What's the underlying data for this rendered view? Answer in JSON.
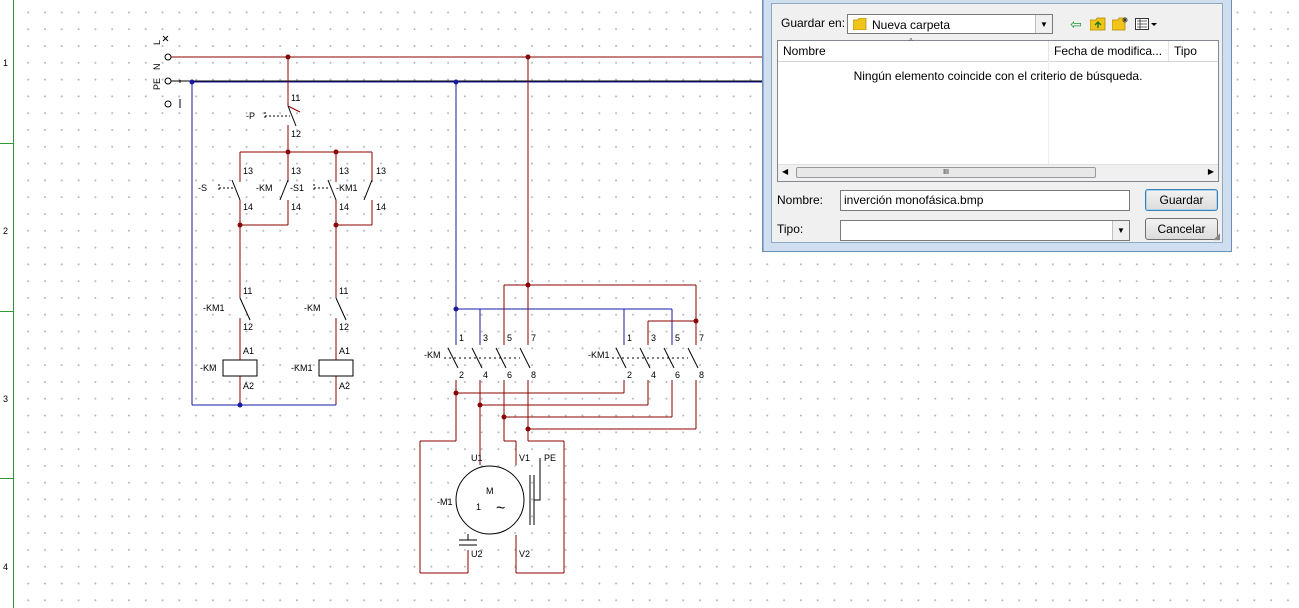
{
  "ruler": {
    "numbers": [
      "1",
      "2",
      "3",
      "4"
    ]
  },
  "schematic": {
    "supply_labels": [
      "L",
      "N",
      "PE"
    ],
    "control_labels": {
      "p": "-P",
      "s": "-S",
      "km_a": "-KM",
      "s1": "-S1",
      "km1_a": "-KM1",
      "km1_b": "-KM1",
      "km_b": "-KM",
      "coil_km": "-KM",
      "coil_km1": "-KM1",
      "n11": "11",
      "n12": "12",
      "n13": "13",
      "n14": "14",
      "a1": "A1",
      "a2": "A2"
    },
    "power_labels": {
      "km": "-KM",
      "km1": "-KM1",
      "top": [
        "1",
        "3",
        "5",
        "7"
      ],
      "bottom": [
        "2",
        "4",
        "6",
        "8"
      ],
      "motor": "-M1",
      "m": "M",
      "one": "1",
      "tilde": "~",
      "u1": "U1",
      "v1": "V1",
      "u2": "U2",
      "v2": "V2",
      "pe": "PE"
    },
    "colors": {
      "phase": "#8b0000",
      "neutral": "#1a1aa0",
      "pe": "#000000"
    }
  },
  "dialog": {
    "save_in_label": "Guardar en:",
    "folder": "Nueva carpeta",
    "columns": [
      "Nombre",
      "Fecha de modifica...",
      "Tipo"
    ],
    "empty_message": "Ningún elemento coincide con el criterio de búsqueda.",
    "name_label": "Nombre:",
    "name_value": "inverción monofásica.bmp",
    "type_label": "Tipo:",
    "type_value": "",
    "save_button": "Guardar",
    "cancel_button": "Cancelar",
    "scroll_thumb": "III"
  }
}
